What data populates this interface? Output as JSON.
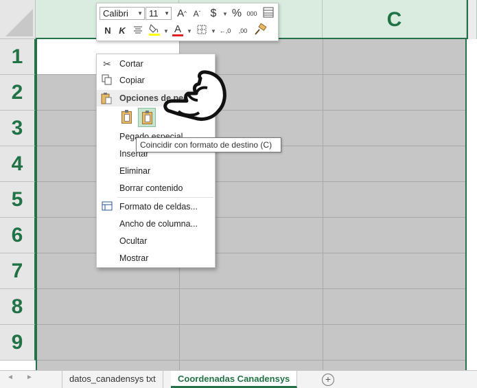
{
  "columns": [
    "",
    "",
    "C"
  ],
  "rows": [
    "1",
    "2",
    "3",
    "4",
    "5",
    "6",
    "7",
    "8",
    "9"
  ],
  "mini_toolbar": {
    "font_name": "Calibri",
    "font_size": "11",
    "buttons": {
      "grow": "A",
      "shrink": "A",
      "currency": "$",
      "percent": "%",
      "comma": "000",
      "bold": "N",
      "italic": "K",
      "font_color": "A",
      "inc_decimal": "←,0",
      "dec_decimal": ",00"
    }
  },
  "context_menu": {
    "cut": "Cortar",
    "copy": "Copiar",
    "paste_options": "Opciones de pegado:",
    "paste_special": "Pegado especial...",
    "insert": "Insertar",
    "delete": "Eliminar",
    "clear": "Borrar contenido",
    "format_cells": "Formato de celdas...",
    "col_width": "Ancho de columna...",
    "hide": "Ocultar",
    "show": "Mostrar"
  },
  "tooltip": "Coincidir con formato de destino (C)",
  "sheet_tabs": [
    "datos_canadensys txt",
    "Coordenadas Canadensys"
  ],
  "add_sheet": "+",
  "colors": {
    "accent": "#217346",
    "selection": "#c6c6c6",
    "header_selected": "#d9ecdf"
  }
}
